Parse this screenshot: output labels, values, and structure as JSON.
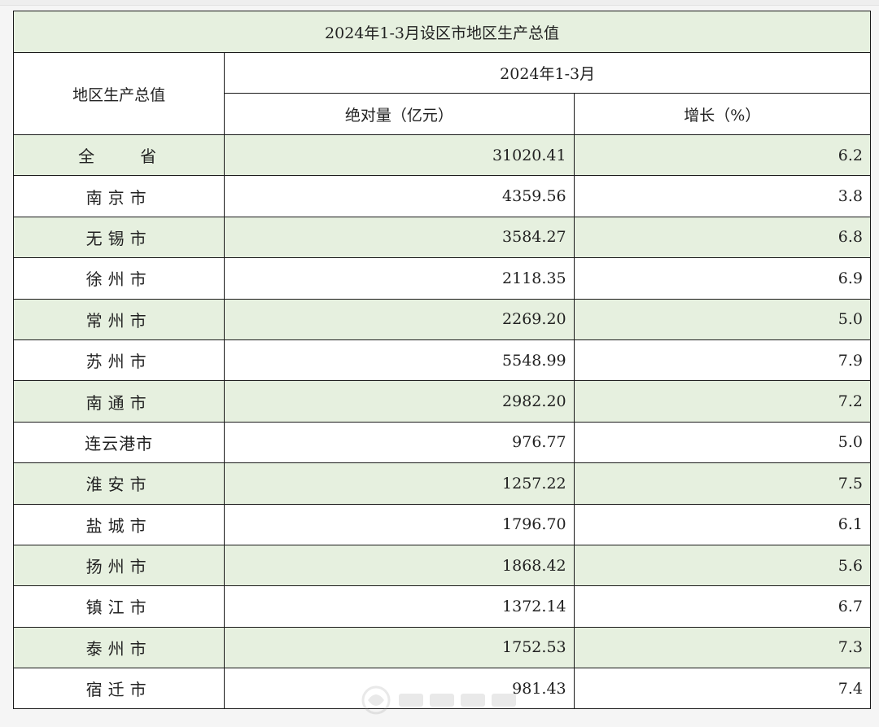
{
  "table": {
    "title": "2024年1-3月设区市地区生产总值",
    "region_header": "地区生产总值",
    "period_header": "2024年1-3月",
    "abs_header": "绝对量（亿元）",
    "growth_header": "增长（%）",
    "rows": [
      {
        "name": "全　省",
        "value": "31020.41",
        "growth": "6.2"
      },
      {
        "name": "南京市",
        "value": "4359.56",
        "growth": "3.8"
      },
      {
        "name": "无锡市",
        "value": "3584.27",
        "growth": "6.8"
      },
      {
        "name": "徐州市",
        "value": "2118.35",
        "growth": "6.9"
      },
      {
        "name": "常州市",
        "value": "2269.20",
        "growth": "5.0"
      },
      {
        "name": "苏州市",
        "value": "5548.99",
        "growth": "7.9"
      },
      {
        "name": "南通市",
        "value": "2982.20",
        "growth": "7.2"
      },
      {
        "name": "连云港市",
        "value": "976.77",
        "growth": "5.0"
      },
      {
        "name": "淮安市",
        "value": "1257.22",
        "growth": "7.5"
      },
      {
        "name": "盐城市",
        "value": "1796.70",
        "growth": "6.1"
      },
      {
        "name": "扬州市",
        "value": "1868.42",
        "growth": "5.6"
      },
      {
        "name": "镇江市",
        "value": "1372.14",
        "growth": "6.7"
      },
      {
        "name": "泰州市",
        "value": "1752.53",
        "growth": "7.3"
      },
      {
        "name": "宿迁市",
        "value": "981.43",
        "growth": "7.4"
      }
    ]
  },
  "colors": {
    "shade": "#e6f0df",
    "border": "#1a1a1a"
  },
  "watermark": {
    "icon": "logo-watermark-icon"
  }
}
